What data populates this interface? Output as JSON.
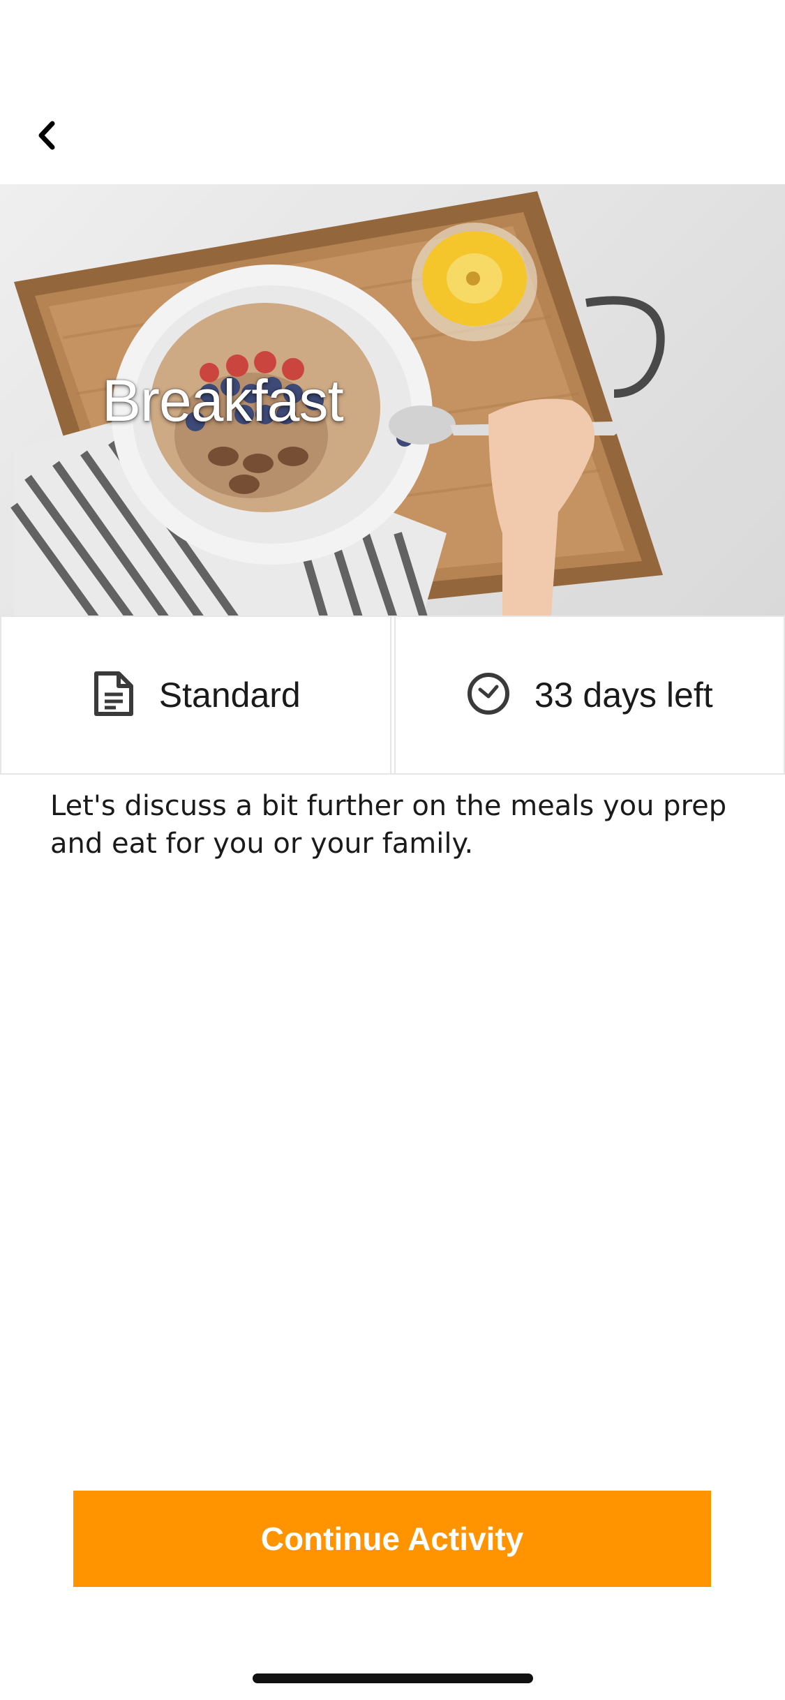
{
  "nav": {
    "back_icon": "chevron-left-icon"
  },
  "hero": {
    "title": "Breakfast",
    "image": "breakfast-tray-photo"
  },
  "info": {
    "type_icon": "document-icon",
    "type_label": "Standard",
    "time_icon": "clock-icon",
    "time_label": "33 days left"
  },
  "description": "Let's discuss a bit further on the meals you prep and eat for you or your family.",
  "actions": {
    "continue_label": "Continue Activity"
  },
  "colors": {
    "accent": "#ff9300",
    "text": "#1a1a1a",
    "divider": "#e6e6e6"
  }
}
